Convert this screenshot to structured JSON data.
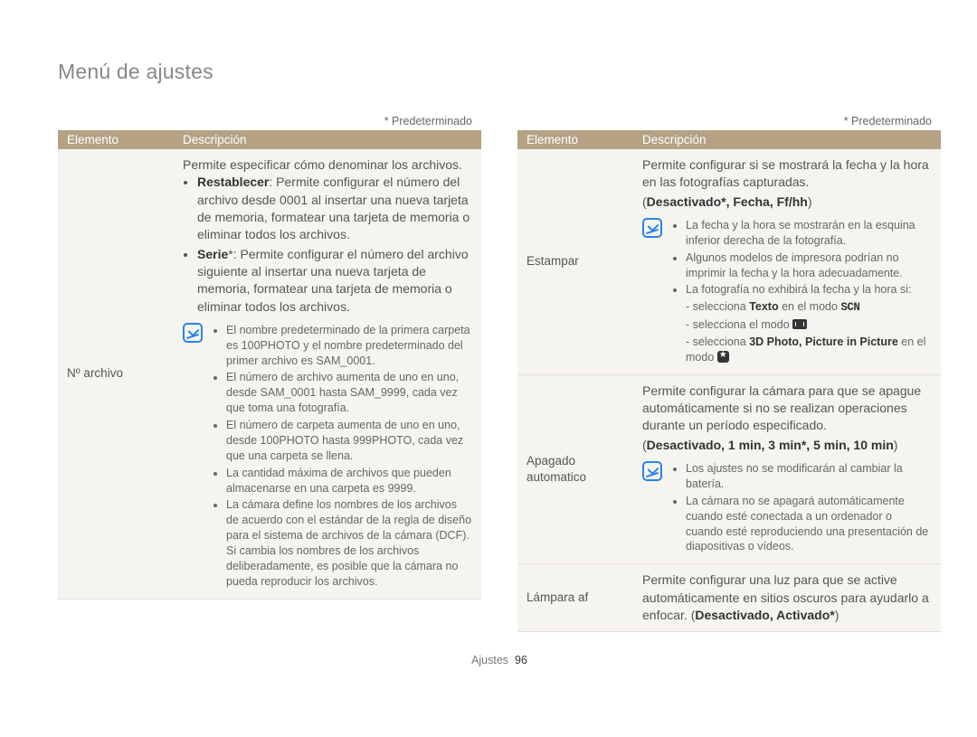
{
  "page_title": "Menú de ajustes",
  "default_note": "* Predeterminado",
  "headers": {
    "element": "Elemento",
    "desc": "Descripción"
  },
  "footer": {
    "section": "Ajustes",
    "page": "96"
  },
  "left": {
    "rows": [
      {
        "element": "Nº archivo",
        "lead": "Permite especificar cómo denominar los archivos.",
        "bullets": [
          {
            "label": "Restablecer",
            "text": ": Permite configurar el número del archivo desde 0001 al insertar una nueva tarjeta de memoria, formatear una tarjeta de memoria o eliminar todos los archivos."
          },
          {
            "label": "Serie",
            "suffix": "*",
            "text": ": Permite configurar el número del archivo siguiente al insertar una nueva tarjeta de memoria, formatear una tarjeta de memoria o eliminar todos los archivos."
          }
        ],
        "note_items": [
          "El nombre predeterminado de la primera carpeta es 100PHOTO y el nombre predeterminado del primer archivo es SAM_0001.",
          "El número de archivo aumenta de uno en uno, desde SAM_0001 hasta SAM_9999, cada vez que toma una fotografía.",
          "El número de carpeta aumenta de uno en uno, desde 100PHOTO hasta 999PHOTO, cada vez que una carpeta se llena.",
          "La cantidad máxima de archivos que pueden almacenarse en una carpeta es 9999.",
          "La cámara define los nombres de los archivos de acuerdo con el estándar de la regla de diseño para el sistema de archivos de la cámara (DCF). Si cambia los nombres de los archivos deliberadamente, es posible que la cámara no pueda reproducir los archivos."
        ]
      }
    ]
  },
  "right": {
    "rows": [
      {
        "element": "Estampar",
        "lead1": "Permite configurar si se mostrará la fecha y la hora en las fotografías capturadas.",
        "options_pre": "(",
        "options": "Desactivado*, Fecha, Ff/hh",
        "options_post": ")",
        "note_items": [
          {
            "text": "La fecha y la hora se mostrarán en la esquina inferior derecha de la fotografía."
          },
          {
            "text": "Algunos modelos de impresora podrían no imprimir la fecha y la hora adecuadamente."
          },
          {
            "text": "La fotografía no exhibirá la fecha y la hora si:",
            "sub": [
              {
                "pre": "selecciona ",
                "bold": "Texto",
                "post": " en el modo ",
                "glyph": "scn"
              },
              {
                "pre": "selecciona el modo ",
                "glyph": "rect"
              },
              {
                "pre": "selecciona ",
                "bold": "3D Photo, Picture in Picture",
                "post": " en el modo ",
                "glyph": "star"
              }
            ]
          }
        ]
      },
      {
        "element": "Apagado automatico",
        "lead1": "Permite configurar la cámara para que se apague automáticamente si no se realizan operaciones durante un período especificado.",
        "options_pre": "(",
        "options": "Desactivado, 1 min, 3 min*, 5 min, 10 min",
        "options_post": ")",
        "note_items": [
          {
            "text": "Los ajustes no se modificarán al cambiar la batería."
          },
          {
            "text": "La cámara no se apagará automáticamente cuando esté conectada a un ordenador o cuando esté reproduciendo una presentación de diapositivas o vídeos."
          }
        ]
      },
      {
        "element": "Lámpara af",
        "lead1": "Permite configurar una luz para que se active automáticamente en sitios oscuros para ayudarlo a enfocar. (",
        "options": "Desactivado, Activado*",
        "options_post": ")"
      }
    ]
  }
}
